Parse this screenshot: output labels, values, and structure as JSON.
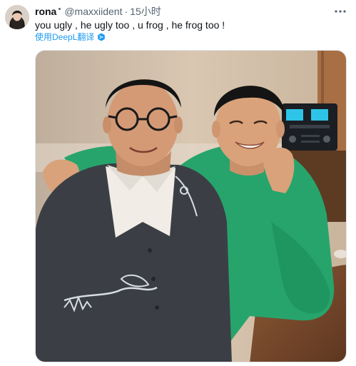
{
  "post": {
    "display_name": "rona",
    "handle": "@maxxiident",
    "separator": "·",
    "time": "15小时",
    "text": "you ugly , he ugly too , u frog  , he frog too !",
    "translate_label": "使用DeepL翻译"
  },
  "icons": {
    "more": "more-horizontal-icon",
    "translate_badge": "deepl-icon"
  },
  "colors": {
    "link": "#1d9bf0",
    "secondary_text": "#536471",
    "primary_text": "#0f1419"
  }
}
